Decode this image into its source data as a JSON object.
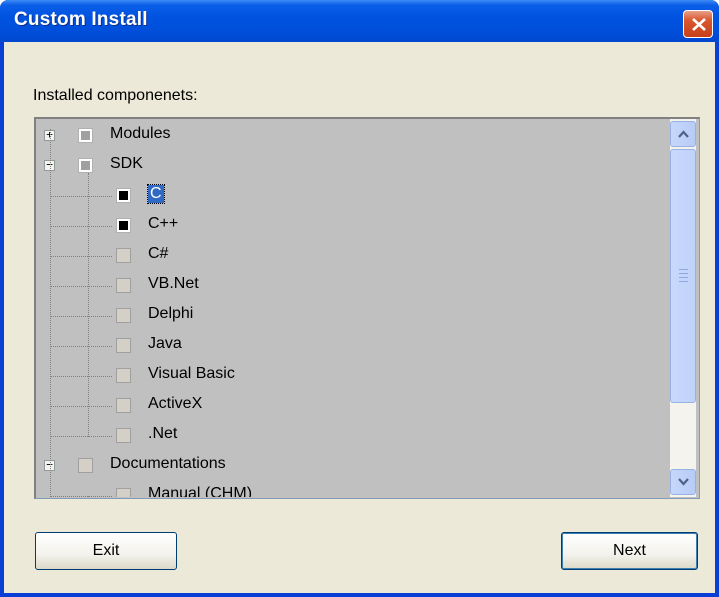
{
  "window": {
    "title": "Custom Install",
    "close_icon": "close-x-icon"
  },
  "group_label": "Installed componenets:",
  "tree": {
    "items": [
      {
        "label": "Modules",
        "level": 0,
        "expander": "+",
        "check": "partial"
      },
      {
        "label": "SDK",
        "level": 0,
        "expander": "−",
        "check": "partial"
      },
      {
        "label": "C",
        "level": 1,
        "check": "full",
        "selected": true
      },
      {
        "label": "C++",
        "level": 1,
        "check": "full"
      },
      {
        "label": "C#",
        "level": 1,
        "check": "empty"
      },
      {
        "label": "VB.Net",
        "level": 1,
        "check": "empty"
      },
      {
        "label": "Delphi",
        "level": 1,
        "check": "empty"
      },
      {
        "label": "Java",
        "level": 1,
        "check": "empty"
      },
      {
        "label": "Visual Basic",
        "level": 1,
        "check": "empty"
      },
      {
        "label": "ActiveX",
        "level": 1,
        "check": "empty"
      },
      {
        "label": ".Net",
        "level": 1,
        "check": "empty"
      },
      {
        "label": "Documentations",
        "level": 0,
        "expander": "−",
        "check": "empty"
      },
      {
        "label": "Manual (CHM)",
        "level": 1,
        "check": "empty"
      }
    ]
  },
  "buttons": {
    "exit": "Exit",
    "next": "Next"
  },
  "colors": {
    "titlebar": "#0053e0",
    "dialog_bg": "#ece9d8",
    "tree_bg": "#c0c0c0"
  }
}
